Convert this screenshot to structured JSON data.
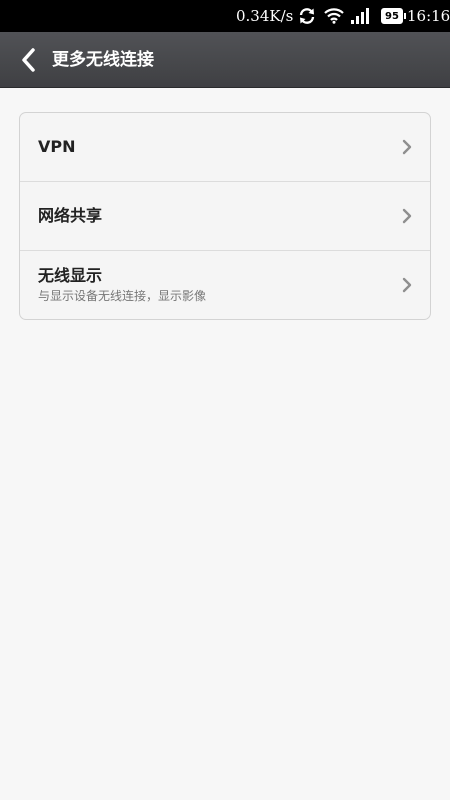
{
  "status_bar": {
    "speed": "0.34K/s",
    "battery": "95",
    "time": "16:16",
    "icons": [
      "sync-icon",
      "wifi-icon",
      "signal-icon",
      "battery-icon"
    ]
  },
  "header": {
    "title": "更多无线连接",
    "back_icon": "back-arrow-icon"
  },
  "list": {
    "items": [
      {
        "label": "VPN",
        "subtitle": ""
      },
      {
        "label": "网络共享",
        "subtitle": ""
      },
      {
        "label": "无线显示",
        "subtitle": "与显示设备无线连接，显示影像"
      }
    ],
    "item_icon": "chevron-right-icon"
  },
  "colors": {
    "background": "#f7f7f7",
    "titlebar": "#47484b",
    "statusbar": "#000000"
  }
}
